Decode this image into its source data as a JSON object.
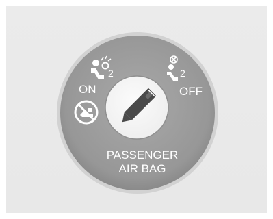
{
  "switch": {
    "on_label": "ON",
    "off_label": "OFF",
    "on_icon_subscript": "2",
    "off_icon_subscript": "2",
    "passenger_label": "PASSENGER",
    "airbag_label": "AIR BAG",
    "key_position": "OFF"
  },
  "colors": {
    "panel": "#e9e9e9",
    "bezel": "#9a9a9a",
    "bezel_rim": "#c9c9c9",
    "center": "#f5f5f5",
    "text": "#ffffff"
  }
}
